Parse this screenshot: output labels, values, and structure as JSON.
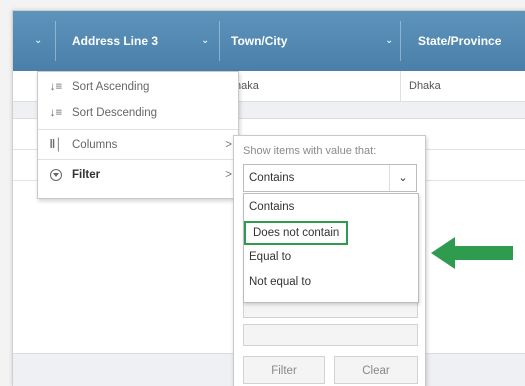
{
  "header": {
    "columns": [
      {
        "label": "Address Line 3"
      },
      {
        "label": "Town/City"
      },
      {
        "label": "State/Province"
      }
    ]
  },
  "rows": [
    {
      "town": "haka",
      "state": "Dhaka"
    }
  ],
  "column_menu": {
    "items": [
      {
        "icon": "sort-ascending-icon",
        "label": "Sort Ascending"
      },
      {
        "icon": "sort-descending-icon",
        "label": "Sort Descending"
      },
      {
        "icon": "columns-icon",
        "label": "Columns",
        "submenu": true
      },
      {
        "icon": "filter-icon",
        "label": "Filter",
        "submenu": true
      }
    ]
  },
  "filter_menu": {
    "show_label": "Show items with value that:",
    "selected_operator": "Contains",
    "options": [
      "Contains",
      "Does not contain",
      "Equal to",
      "Not equal to"
    ],
    "highlighted_option": "Does not contain",
    "filter_button": "Filter",
    "clear_button": "Clear"
  },
  "colors": {
    "header_bg": "#5089b5",
    "highlight_border": "#2e9b4f",
    "arrow": "#2e9b4f"
  }
}
